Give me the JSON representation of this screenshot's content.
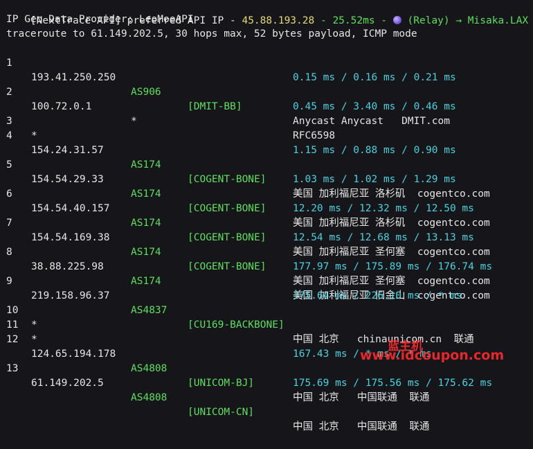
{
  "header": {
    "prefix": "[NextTrace API] preferred API IP - ",
    "api_ip": "45.88.193.28",
    "sep": " - ",
    "latency": "25.52ms",
    "dash": " - ",
    "relay_icon": "relay-globe-icon",
    "relay": " (Relay) → Misaka.LAX"
  },
  "provider_line": "IP Geo Data Provider: LeoMoeAPI",
  "traceroute_line": "traceroute to 61.149.202.5, 30 hops max, 52 bytes payload, ICMP mode",
  "hops": [
    {
      "num": "1",
      "ip": "193.41.250.250",
      "asn": "AS906",
      "net": "[DMIT-BB]",
      "geo": "Anycast Anycast   DMIT.com",
      "rtt": "0.15 ms / 0.16 ms / 0.21 ms"
    },
    {
      "num": "2",
      "ip": "100.72.0.1",
      "star": "*",
      "geo": "RFC6598",
      "rtt": "0.45 ms / 3.40 ms / 0.46 ms"
    },
    {
      "num": "3",
      "ip": "*"
    },
    {
      "num": "4",
      "ip": "154.24.31.57",
      "asn": "AS174",
      "net": "[COGENT-BONE]",
      "geo": "美国 加利福尼亚 洛杉矶  cogentco.com",
      "rtt": "1.15 ms / 0.88 ms / 0.90 ms"
    },
    {
      "num": "5",
      "ip": "154.54.29.33",
      "asn": "AS174",
      "net": "[COGENT-BONE]",
      "geo": "美国 加利福尼亚 洛杉矶  cogentco.com",
      "rtt": "1.03 ms / 1.02 ms / 1.29 ms"
    },
    {
      "num": "6",
      "ip": "154.54.40.157",
      "asn": "AS174",
      "net": "[COGENT-BONE]",
      "geo": "美国 加利福尼亚 圣何塞  cogentco.com",
      "rtt": "12.20 ms / 12.32 ms / 12.50 ms"
    },
    {
      "num": "7",
      "ip": "154.54.169.38",
      "asn": "AS174",
      "net": "[COGENT-BONE]",
      "geo": "美国 加利福尼亚 圣何塞  cogentco.com",
      "rtt": "12.54 ms / 12.68 ms / 13.13 ms"
    },
    {
      "num": "8",
      "ip": "38.88.225.98",
      "asn": "AS174",
      "geo": "美国 加利福尼亚 旧金山  cogentco.com",
      "rtt": "177.97 ms / 175.89 ms / 176.74 ms"
    },
    {
      "num": "9",
      "ip": "219.158.96.37",
      "asn": "AS4837",
      "net": "[CU169-BACKBONE]",
      "geo": "中国 北京   chinaunicom.cn  联通",
      "rtt": "175.64 ms / 226.10 ms / * ms"
    },
    {
      "num": "10",
      "ip": "*"
    },
    {
      "num": "11",
      "ip": "*"
    },
    {
      "num": "12",
      "ip": "124.65.194.178",
      "asn": "AS4808",
      "net": "[UNICOM-BJ]",
      "geo": "中国 北京   中国联通  联通",
      "rtt": "167.43 ms / * ms / * ms"
    },
    {
      "num": "13",
      "ip": "61.149.202.5",
      "asn": "AS4808",
      "net": "[UNICOM-CN]",
      "geo": "中国 北京   中国联通  联通",
      "rtt": "175.69 ms / 175.56 ms / 175.62 ms"
    }
  ],
  "watermark": {
    "top": "蓝主机",
    "bottom": "www.idcoupon.com"
  },
  "colors": {
    "background": "#15151a",
    "green": "#5ce05c",
    "cyan": "#48d3e0",
    "yellow": "#e6db74",
    "watermark": "#ff2a2a"
  }
}
